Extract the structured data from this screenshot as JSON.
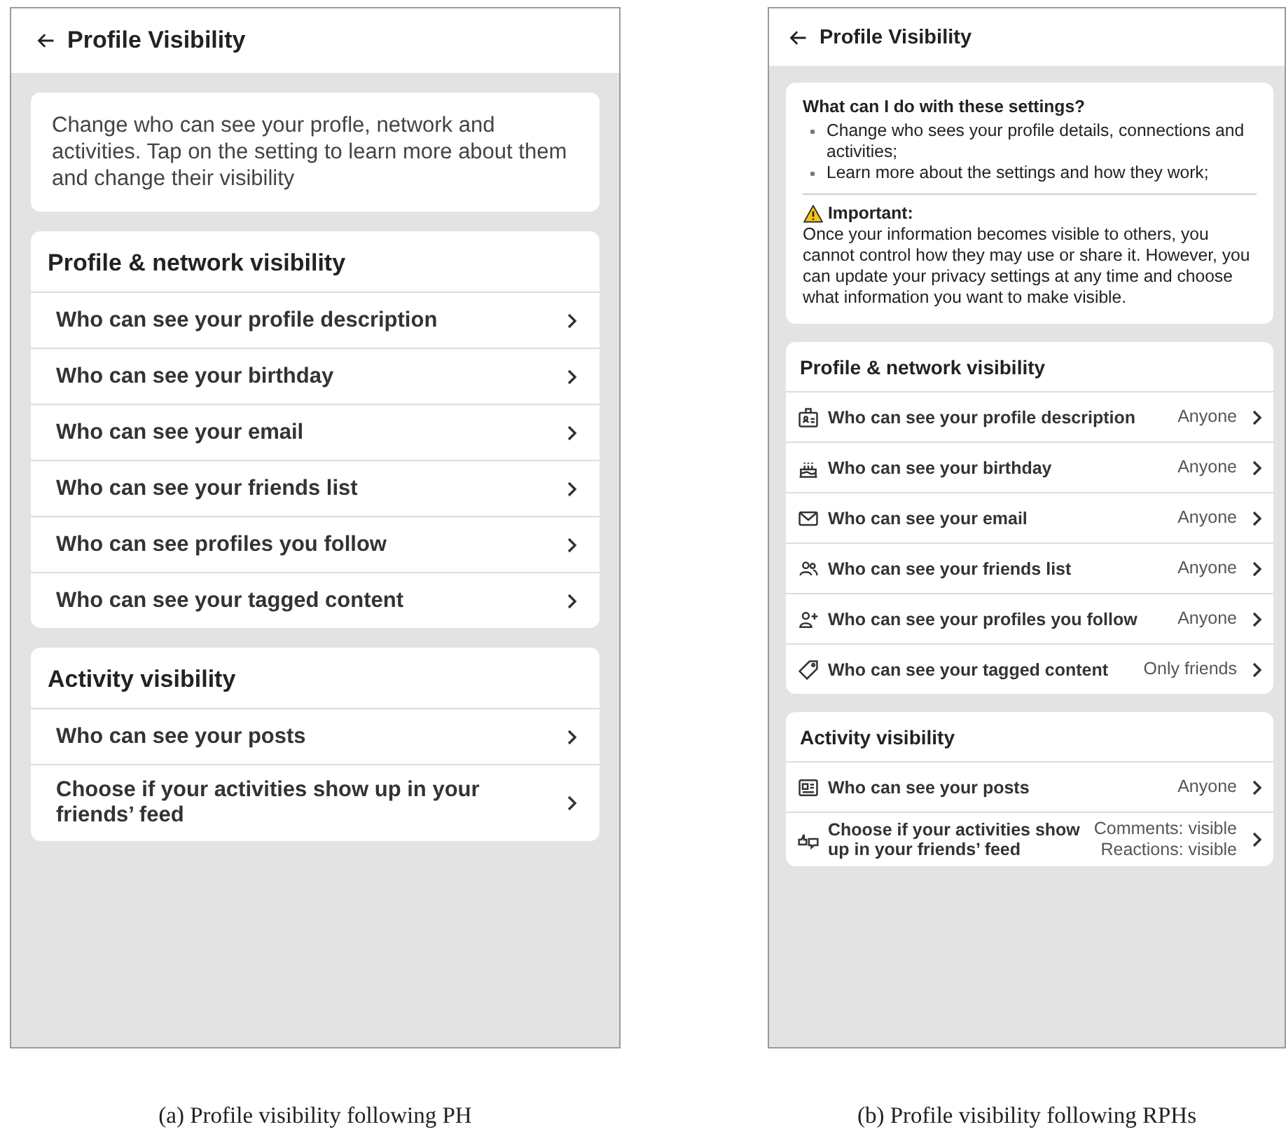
{
  "panels": [
    {
      "title": "Profile Visibility",
      "intro": {
        "kind": "text",
        "text": "Change who can see your profle, network and activities. Tap on the setting to learn more about them and change their visibility"
      },
      "sections": [
        {
          "heading": "Profile & network visibility",
          "items": [
            {
              "label": "Who can see your profile description"
            },
            {
              "label": "Who can see your birthday"
            },
            {
              "label": "Who can see your email"
            },
            {
              "label": "Who can see your friends list"
            },
            {
              "label": "Who can see profiles you follow"
            },
            {
              "label": "Who can see your tagged content"
            }
          ]
        },
        {
          "heading": "Activity visibility",
          "items": [
            {
              "label": "Who can see your posts"
            },
            {
              "label": "Choose if your activities show up in your friends’ feed"
            }
          ]
        }
      ],
      "caption": "(a) Profile visibility following PH"
    },
    {
      "title": "Profile Visibility",
      "intro": {
        "kind": "info",
        "heading": "What can I do with these settings?",
        "bullets": [
          "Change who sees your profile details, connections and activities;",
          "Learn more about the settings and how they work;"
        ],
        "warning_title": "Important:",
        "warning_text": "Once your information becomes visible to others, you cannot control how they may use or share it. However, you can update your privacy settings at any time and choose what information you want to make visible."
      },
      "sections": [
        {
          "heading": "Profile & network visibility",
          "items": [
            {
              "label": "Who can see your profile description",
              "values": [
                "Anyone"
              ]
            },
            {
              "label": "Who can see your birthday",
              "values": [
                "Anyone"
              ]
            },
            {
              "label": "Who can see your email",
              "values": [
                "Anyone"
              ]
            },
            {
              "label": "Who can see your friends list",
              "values": [
                "Anyone"
              ]
            },
            {
              "label": "Who can see your profiles you follow",
              "values": [
                "Anyone"
              ]
            },
            {
              "label": "Who can see your tagged content",
              "values": [
                "Only friends"
              ]
            }
          ]
        },
        {
          "heading": "Activity visibility",
          "items": [
            {
              "label": "Who can see your posts",
              "values": [
                "Anyone"
              ]
            },
            {
              "label": "Choose if your activities show up in your friends’ feed",
              "values": [
                "Comments: visible",
                "Reactions: visible"
              ]
            }
          ]
        }
      ],
      "caption": "(b) Profile visibility following RPHs"
    }
  ]
}
